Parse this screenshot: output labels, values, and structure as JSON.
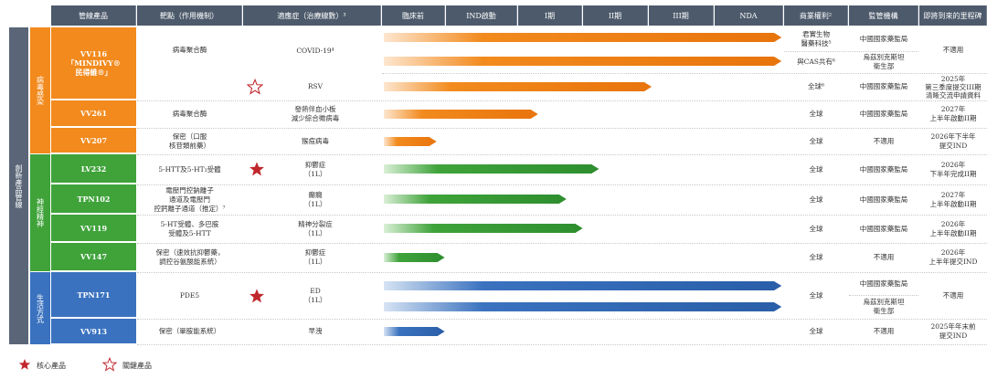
{
  "headers": {
    "product": "管線產品",
    "target": "靶點（作用機制）",
    "indication": "適應症（治療線數）³",
    "preclinical": "臨床前",
    "ind": "IND啟動",
    "phase1": "I期",
    "phase2": "II期",
    "phase3": "III期",
    "nda": "NDA",
    "rights": "商業權利²",
    "regulator": "監管機構",
    "milestone": "即將到來的里程碑"
  },
  "categories": {
    "main": "創新產品管線",
    "virus": "病毒感染",
    "cns": "神經精神",
    "lifestyle": "生活方式"
  },
  "rows": [
    {
      "product": "VV116\n「MINDIVY®\n民得維®」",
      "target": "病毒聚合酶",
      "indication": "COVID-19⁴",
      "rights": "君實生物\n醫藥科技⁵",
      "regulator": "中國國家藥監局",
      "milestone": "不適用"
    },
    {
      "product": "",
      "target": "",
      "indication": "",
      "rights": "與CAS共有⁶",
      "regulator": "烏茲別克斯坦\n衛生部",
      "milestone": ""
    },
    {
      "product": "",
      "target": "",
      "indication": "RSV",
      "rights": "全球⁶",
      "regulator": "中國國家藥監局",
      "milestone": "2025年\n第三季度提交III期\n清晰交流申請資料"
    },
    {
      "product": "VV261",
      "target": "病毒聚合酶",
      "indication": "發熱伴血小板\n減少綜合徵病毒",
      "rights": "全球",
      "regulator": "中國國家藥監局",
      "milestone": "2027年\n上半年啟動II期"
    },
    {
      "product": "VV207",
      "target": "保密（口服\n核苷類前藥）",
      "indication": "猴痘病毒",
      "rights": "全球",
      "regulator": "不適用",
      "milestone": "2026年下半年\n提交IND"
    },
    {
      "product": "LV232",
      "target": "5-HTT及5-HT₃受體",
      "indication": "抑鬱症\n（1L）",
      "rights": "全球",
      "regulator": "中國國家藥監局",
      "milestone": "2026年\n下半年完成II期"
    },
    {
      "product": "TPN102",
      "target": "電壓門控鈉離子\n通道及電壓門\n控鈣離子通道（推定）⁷",
      "indication": "癲癇\n（1L）",
      "rights": "全球",
      "regulator": "中國國家藥監局",
      "milestone": "2027年\n上半年啟動II期"
    },
    {
      "product": "VV119",
      "target": "5-HT受體、多巴胺\n受體及5-HTT",
      "indication": "精神分裂症\n（1L）",
      "rights": "全球",
      "regulator": "中國國家藥監局",
      "milestone": "2026年\n上半年啟動II期"
    },
    {
      "product": "VV147",
      "target": "保密（速效抗抑鬱藥，\n調控谷氨酸能系統）",
      "indication": "抑鬱症\n（1L）",
      "rights": "全球",
      "regulator": "不適用",
      "milestone": "2026年\n上半年提交IND"
    },
    {
      "product": "TPN171",
      "target": "PDE5",
      "indication": "ED\n（1L）",
      "rights": "全球",
      "regulator": "中國國家藥監局",
      "milestone": "不適用"
    },
    {
      "product": "",
      "target": "",
      "indication": "",
      "rights": "",
      "regulator": "烏茲別克斯坦\n衛生部",
      "milestone": ""
    },
    {
      "product": "VV913",
      "target": "保密（單胺能系統）",
      "indication": "早洩",
      "rights": "全球",
      "regulator": "不適用",
      "milestone": "2025年年末前\n提交IND"
    }
  ],
  "progress": [
    {
      "row": 0,
      "fraction": 0.98,
      "color": "orange"
    },
    {
      "row": 1,
      "fraction": 0.98,
      "color": "orange"
    },
    {
      "row": 2,
      "fraction": 0.66,
      "color": "orange"
    },
    {
      "row": 3,
      "fraction": 0.38,
      "color": "orange"
    },
    {
      "row": 4,
      "fraction": 0.13,
      "color": "orange"
    },
    {
      "row": 5,
      "fraction": 0.53,
      "color": "green"
    },
    {
      "row": 6,
      "fraction": 0.45,
      "color": "green"
    },
    {
      "row": 7,
      "fraction": 0.49,
      "color": "green"
    },
    {
      "row": 8,
      "fraction": 0.15,
      "color": "green"
    },
    {
      "row": 9,
      "fraction": 0.98,
      "color": "blue"
    },
    {
      "row": 10,
      "fraction": 0.98,
      "color": "blue"
    },
    {
      "row": 11,
      "fraction": 0.15,
      "color": "blue"
    }
  ],
  "legend": {
    "core": "核心產品",
    "key": "關鍵產品"
  },
  "colors": {
    "header": "#4d5a6b",
    "orange": "#f28a1d",
    "orange_dark": "#e8740c",
    "green": "#3fa33a",
    "green_dark": "#2e8e2e",
    "blue": "#3a72bf",
    "blue_dark": "#2a5ea8",
    "main_bar": "#5a6677",
    "star_red": "#c0272d"
  }
}
